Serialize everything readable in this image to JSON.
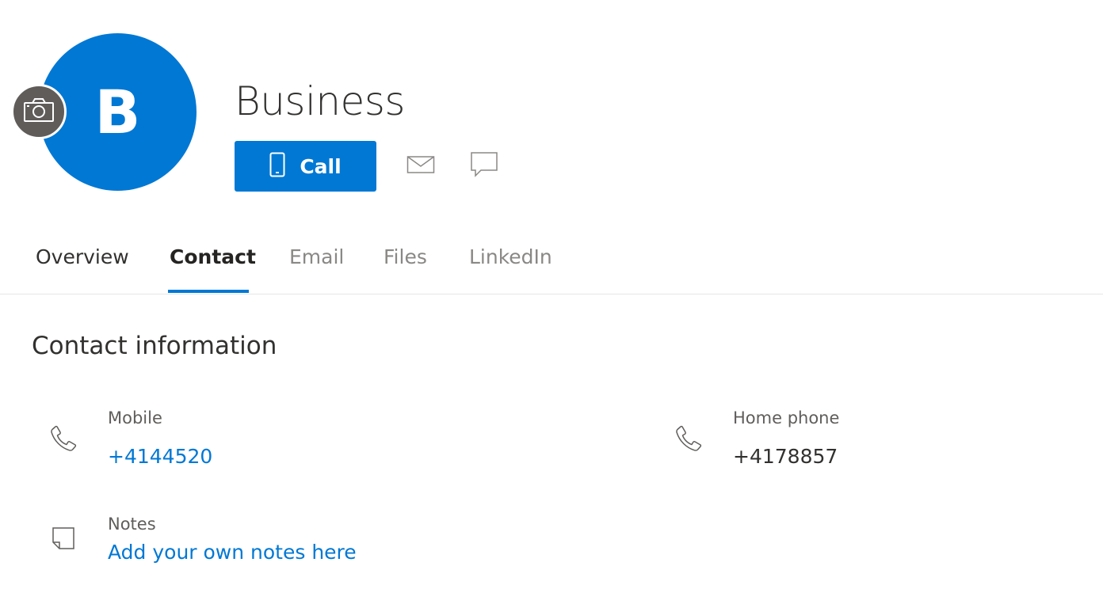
{
  "profile": {
    "initial": "B",
    "name": "Business",
    "avatar_color": "#0078d4",
    "change_photo_icon": "camera-icon"
  },
  "actions": {
    "call_label": "Call",
    "call_icon": "mobile-phone-icon",
    "email_icon": "mail-icon",
    "chat_icon": "chat-icon"
  },
  "tabs": [
    {
      "label": "Overview",
      "active": false
    },
    {
      "label": "Contact",
      "active": true
    },
    {
      "label": "Email",
      "active": false
    },
    {
      "label": "Files",
      "active": false
    },
    {
      "label": "LinkedIn",
      "active": false
    }
  ],
  "contact": {
    "section_title": "Contact information",
    "mobile": {
      "label": "Mobile",
      "value": "+4144520",
      "icon": "phone-icon"
    },
    "home_phone": {
      "label": "Home phone",
      "value": "+4178857",
      "icon": "phone-icon"
    },
    "notes": {
      "label": "Notes",
      "placeholder": "Add your own notes here",
      "icon": "note-icon"
    }
  },
  "colors": {
    "accent": "#0078d4",
    "text": "#323130",
    "muted": "#8a8886"
  }
}
